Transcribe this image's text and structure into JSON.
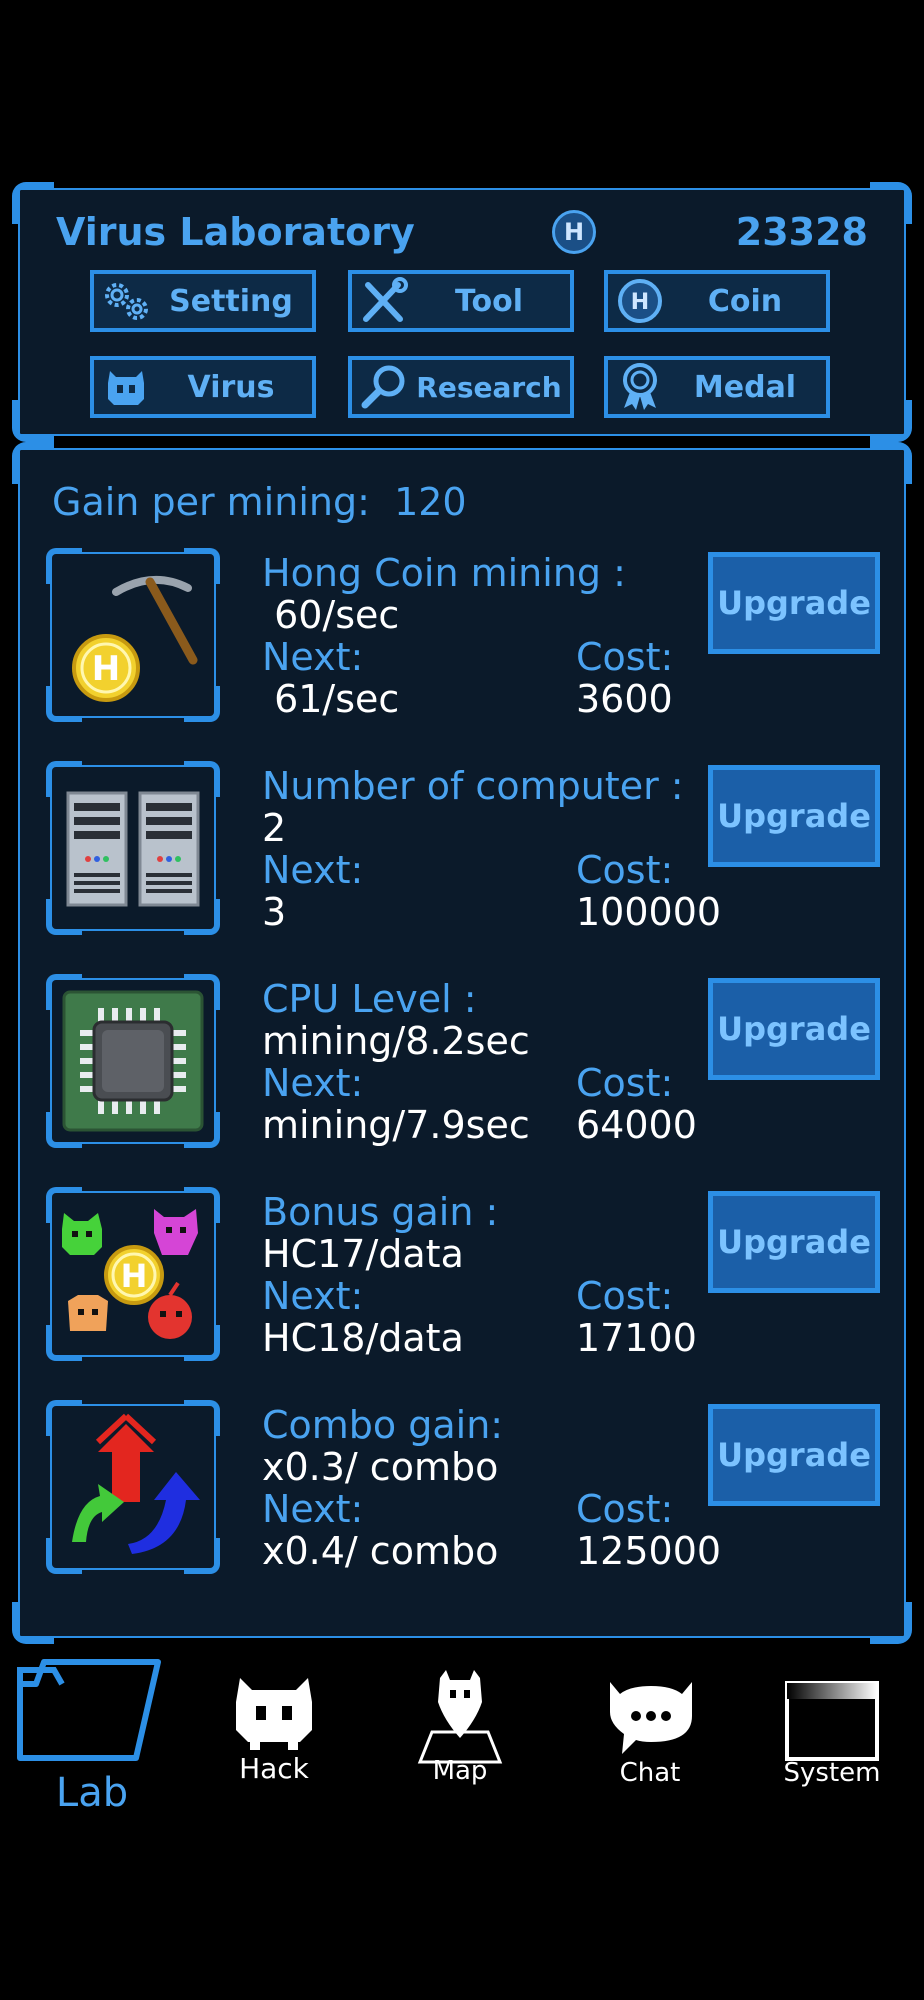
{
  "header": {
    "title": "Virus Laboratory",
    "coin_symbol": "H",
    "coins": "23328",
    "menu": [
      {
        "label": "Setting",
        "icon": "gears-icon"
      },
      {
        "label": "Tool",
        "icon": "tools-icon"
      },
      {
        "label": "Coin",
        "icon": "coin-icon"
      },
      {
        "label": "Virus",
        "icon": "virus-icon"
      },
      {
        "label": "Research",
        "icon": "magnifier-icon"
      },
      {
        "label": "Medal",
        "icon": "medal-icon"
      }
    ]
  },
  "main": {
    "gain_label": "Gain per mining:",
    "gain_value": "120",
    "upgrades": [
      {
        "title": "Hong Coin mining :",
        "current": " 60/sec",
        "next_label": "Next:",
        "next": " 61/sec",
        "cost_label": "Cost:",
        "cost": "3600",
        "button": "Upgrade",
        "icon": "pickaxe-coin-icon"
      },
      {
        "title": "Number of computer :",
        "current": "2",
        "next_label": "Next:",
        "next": "3",
        "cost_label": "Cost:",
        "cost": "100000",
        "button": "Upgrade",
        "icon": "computer-icon"
      },
      {
        "title": "CPU Level :",
        "current": "mining/8.2sec",
        "next_label": "Next:",
        "next": "mining/7.9sec",
        "cost_label": "Cost:",
        "cost": "64000",
        "button": "Upgrade",
        "icon": "cpu-chip-icon"
      },
      {
        "title": "Bonus gain :",
        "current": "HC17/data",
        "next_label": "Next:",
        "next": "HC18/data",
        "cost_label": "Cost:",
        "cost": "17100",
        "button": "Upgrade",
        "icon": "monsters-coin-icon"
      },
      {
        "title": "Combo gain:",
        "current": "x0.3/ combo",
        "next_label": "Next:",
        "next": "x0.4/ combo",
        "cost_label": "Cost:",
        "cost": "125000",
        "button": "Upgrade",
        "icon": "combo-arrows-icon"
      }
    ]
  },
  "nav": [
    {
      "label": "Lab",
      "icon": "folder-icon",
      "active": true
    },
    {
      "label": "Hack",
      "icon": "invader-icon"
    },
    {
      "label": "Map",
      "icon": "map-pin-icon"
    },
    {
      "label": "Chat",
      "icon": "chat-bubble-icon"
    },
    {
      "label": "System",
      "icon": "window-icon"
    }
  ],
  "colors": {
    "accent": "#2c8fe6",
    "text_blue": "#4aa3f0",
    "panel": "#0b1a2a",
    "background": "#000000"
  }
}
